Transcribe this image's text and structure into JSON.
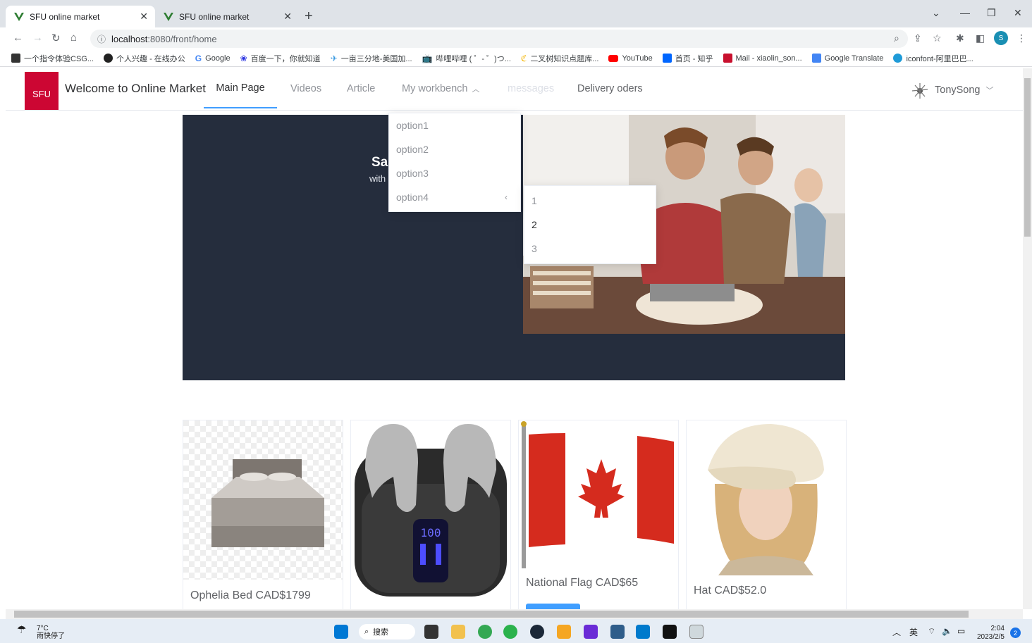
{
  "browser": {
    "tabs": [
      {
        "title": "SFU online market",
        "active": true
      },
      {
        "title": "SFU online market",
        "active": false
      }
    ],
    "url_host": "localhost",
    "url_path": ":8080/front/home",
    "bookmarks": [
      {
        "label": "一个指令体验CSG...",
        "color": "#333333"
      },
      {
        "label": "个人兴趣 - 在线办公",
        "color": "#222222"
      },
      {
        "label": "Google",
        "color": "#4285f4"
      },
      {
        "label": "百度一下，你就知道",
        "color": "#2932e1"
      },
      {
        "label": "一亩三分地-美国加...",
        "color": "#3b9ae1"
      },
      {
        "label": "哔哩哔哩 ( ゜- ゜)つ...",
        "color": "#00a1d6"
      },
      {
        "label": "二叉树知识点题库...",
        "color": "#f4b400"
      },
      {
        "label": "YouTube",
        "color": "#ff0000"
      },
      {
        "label": "首页 - 知乎",
        "color": "#0066ff"
      },
      {
        "label": "Mail - xiaolin_son...",
        "color": "#c8102e"
      },
      {
        "label": "Google Translate",
        "color": "#4285f4"
      },
      {
        "label": "iconfont-阿里巴巴...",
        "color": "#1f9bd8"
      }
    ],
    "profile_initial": "S"
  },
  "header": {
    "logo_text": "SFU",
    "site_title": "Welcome to Online Market",
    "menu": {
      "main_page": "Main Page",
      "videos": "Videos",
      "article": "Article",
      "workbench": "My workbench",
      "messages": "messages",
      "delivery": "Delivery oders"
    },
    "user_name": "TonySong"
  },
  "dropdown": {
    "options": [
      "option1",
      "option2",
      "option3",
      "option4"
    ],
    "submenu": [
      "1",
      "2",
      "3"
    ]
  },
  "hero": {
    "title_partial": "Sa",
    "subtitle_partial": "with"
  },
  "products": [
    {
      "caption": "Ophelia Bed CAD$1799"
    },
    {
      "caption": ""
    },
    {
      "caption": "National Flag CAD$65"
    },
    {
      "caption": "Hat CAD$52.0"
    }
  ],
  "taskbar": {
    "weather_temp": "7°C",
    "weather_desc": "雨快停了",
    "search_label": "搜索",
    "ime": "英",
    "time": "2:04",
    "date": "2023/2/5",
    "notification_count": "2"
  },
  "colors": {
    "accent": "#409eff",
    "logo_red": "#cc0633",
    "hero_bg": "#252d3d"
  }
}
